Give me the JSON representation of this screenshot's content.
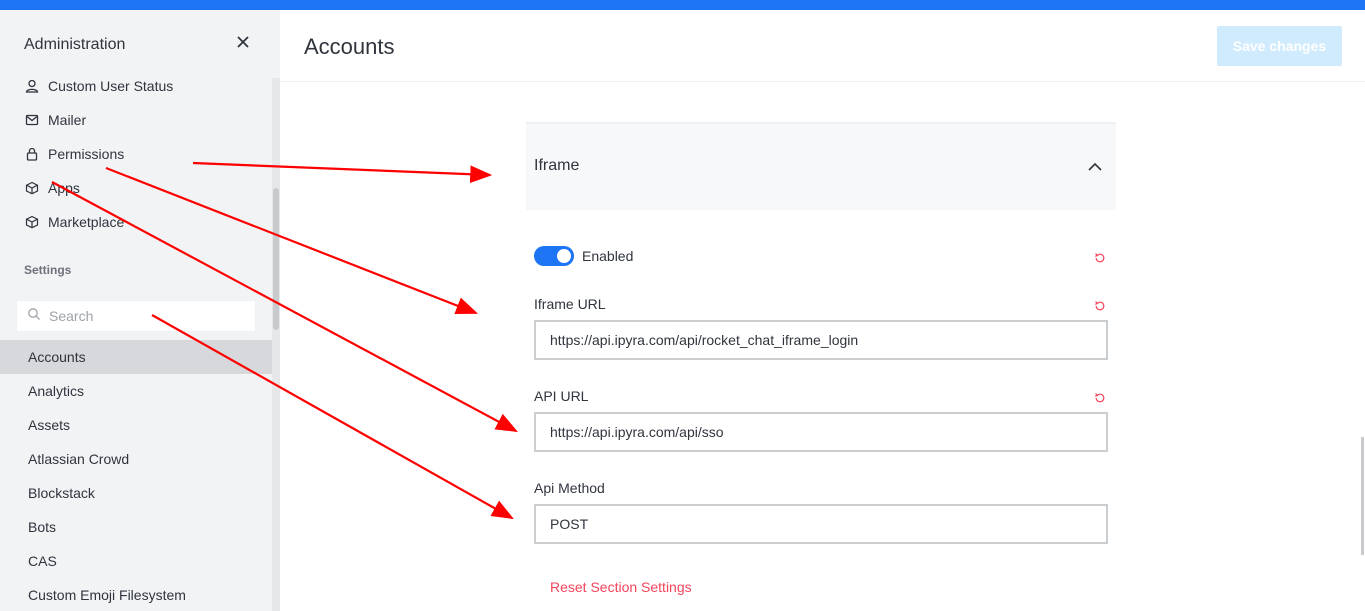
{
  "sidebar": {
    "title": "Administration",
    "close_icon": "close-icon",
    "nav_items": [
      {
        "label": "Custom User Status",
        "icon": "user-icon"
      },
      {
        "label": "Mailer",
        "icon": "mail-icon"
      },
      {
        "label": "Permissions",
        "icon": "lock-icon"
      },
      {
        "label": "Apps",
        "icon": "cube-icon"
      },
      {
        "label": "Marketplace",
        "icon": "cube-icon"
      }
    ],
    "section_label": "Settings",
    "search": {
      "placeholder": "Search",
      "value": ""
    },
    "settings_items": [
      {
        "label": "Accounts",
        "active": true
      },
      {
        "label": "Analytics"
      },
      {
        "label": "Assets"
      },
      {
        "label": "Atlassian Crowd"
      },
      {
        "label": "Blockstack"
      },
      {
        "label": "Bots"
      },
      {
        "label": "CAS"
      },
      {
        "label": "Custom Emoji Filesystem"
      }
    ]
  },
  "header": {
    "title": "Accounts",
    "save_label": "Save changes"
  },
  "section": {
    "title": "Iframe",
    "expanded": true,
    "enabled_label": "Enabled",
    "enabled": true,
    "iframe_url_label": "Iframe URL",
    "iframe_url_value": "https://api.ipyra.com/api/rocket_chat_iframe_login",
    "api_url_label": "API URL",
    "api_url_value": "https://api.ipyra.com/api/sso",
    "api_method_label": "Api Method",
    "api_method_value": "POST",
    "reset_label": "Reset Section Settings"
  },
  "colors": {
    "accent": "#1d74f5",
    "danger": "#f5455c",
    "annotation_arrow": "#ff0000"
  }
}
